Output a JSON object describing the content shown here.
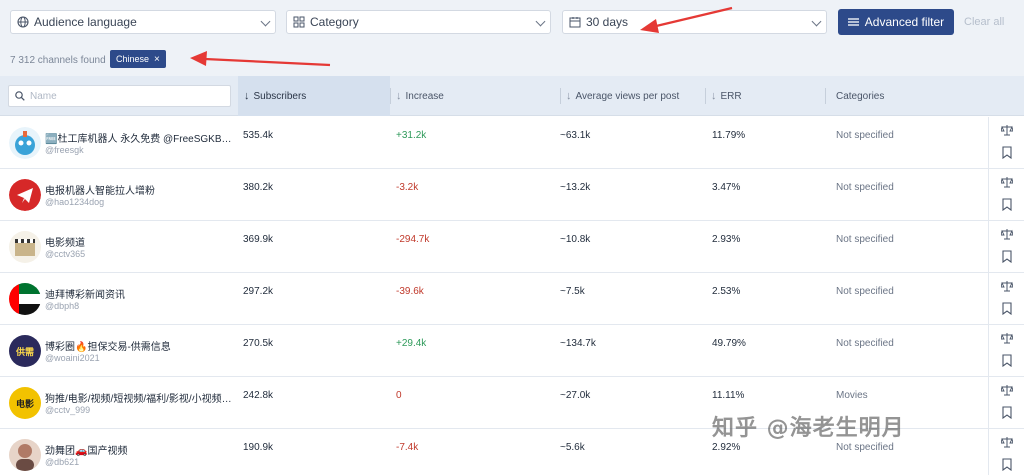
{
  "filters": {
    "audience_language": "Audience language",
    "category": "Category",
    "period": "30 days",
    "advanced_filter": "Advanced filter",
    "clear_all": "Clear all"
  },
  "results": {
    "found_text": "7 312 channels found",
    "active_chip": "Chinese",
    "chip_remove": "×"
  },
  "search": {
    "placeholder": "Name"
  },
  "columns": {
    "subscribers": "Subscribers",
    "increase": "Increase",
    "avg_views": "Average views per post",
    "err": "ERR",
    "categories": "Categories"
  },
  "rows": [
    {
      "name": "🆓杜工库机器人 永久免费 @FreeSGKBOT ...",
      "handle": "@freesgk",
      "subscribers": "535.4k",
      "increase": "+31.2k",
      "trend": "up",
      "avg_views": "~63.1k",
      "err": "11.79%",
      "category": "Not specified",
      "avatar": "robot-avatar",
      "avatar_color": "#3aa3d8"
    },
    {
      "name": "电报机器人智能拉人增粉",
      "handle": "@hao1234dog",
      "subscribers": "380.2k",
      "increase": "-3.2k",
      "trend": "down",
      "avg_views": "~13.2k",
      "err": "3.47%",
      "category": "Not specified",
      "avatar": "telegram-avatar",
      "avatar_color": "#d62828"
    },
    {
      "name": "电影频道",
      "handle": "@cctv365",
      "subscribers": "369.9k",
      "increase": "-294.7k",
      "trend": "down",
      "avg_views": "~10.8k",
      "err": "2.93%",
      "category": "Not specified",
      "avatar": "clapper-avatar",
      "avatar_color": "#c9b48a"
    },
    {
      "name": "迪拜博彩新闻资讯",
      "handle": "@dbph8",
      "subscribers": "297.2k",
      "increase": "-39.6k",
      "trend": "down",
      "avg_views": "~7.5k",
      "err": "2.53%",
      "category": "Not specified",
      "avatar": "uae-flag-avatar",
      "avatar_color": "#00732f"
    },
    {
      "name": "博彩圈🔥担保交易-供需信息",
      "handle": "@woaini2021",
      "subscribers": "270.5k",
      "increase": "+29.4k",
      "trend": "up",
      "avg_views": "~134.7k",
      "err": "49.79%",
      "category": "Not specified",
      "avatar": "supply-avatar",
      "avatar_color": "#2b2a5c",
      "avatar_text": "供需"
    },
    {
      "name": "狗推/电影/视频/短视频/福利/影视/小视频😊...",
      "handle": "@cctv_999",
      "subscribers": "242.8k",
      "increase": "0",
      "trend": "flat",
      "avg_views": "~27.0k",
      "err": "11.11%",
      "category": "Movies",
      "avatar": "movie-logo-avatar",
      "avatar_color": "#f2c200",
      "avatar_text": "电影"
    },
    {
      "name": "劲舞团🚗国产视频",
      "handle": "@db621",
      "subscribers": "190.9k",
      "increase": "-7.4k",
      "trend": "down",
      "avg_views": "~5.6k",
      "err": "2.92%",
      "category": "Not specified",
      "avatar": "person-avatar",
      "avatar_color": "#b07a66"
    }
  ],
  "watermark": "知乎 @海老生明月",
  "colors": {
    "primary": "#2d4a8a",
    "positive": "#2e9a5a",
    "negative": "#c0392b",
    "annotation": "#e53935"
  }
}
